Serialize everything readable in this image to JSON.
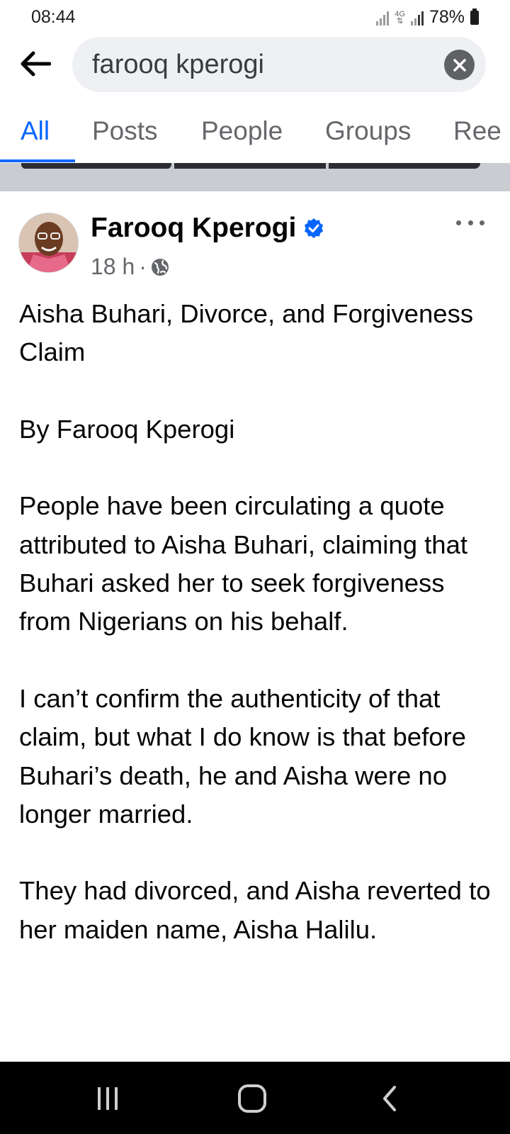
{
  "status": {
    "time": "08:44",
    "network": "4G",
    "battery": "78%"
  },
  "search": {
    "query": "farooq kperogi",
    "back_icon": "arrow-left-icon",
    "clear_icon": "close-circle-icon"
  },
  "tabs": [
    {
      "label": "All",
      "active": true
    },
    {
      "label": "Posts",
      "active": false
    },
    {
      "label": "People",
      "active": false
    },
    {
      "label": "Groups",
      "active": false
    },
    {
      "label": "Ree",
      "active": false
    }
  ],
  "post": {
    "author": "Farooq Kperogi",
    "verified": true,
    "time": "18 h",
    "privacy_icon": "globe-icon",
    "paragraphs": [
      "Aisha Buhari, Divorce, and Forgiveness Claim",
      "By Farooq Kperogi",
      "People have been circulating a quote attributed to Aisha Buhari, claiming that Buhari asked her to seek forgiveness from Nigerians on his behalf.",
      "I can’t confirm the authenticity of that claim, but what I do know is that before Buhari’s death, he and Aisha were no longer married.",
      "They had divorced, and Aisha reverted to her maiden name, Aisha Halilu."
    ]
  },
  "colors": {
    "accent": "#0866ff",
    "secondary_text": "#65676b",
    "search_bg": "#eef0f3"
  }
}
